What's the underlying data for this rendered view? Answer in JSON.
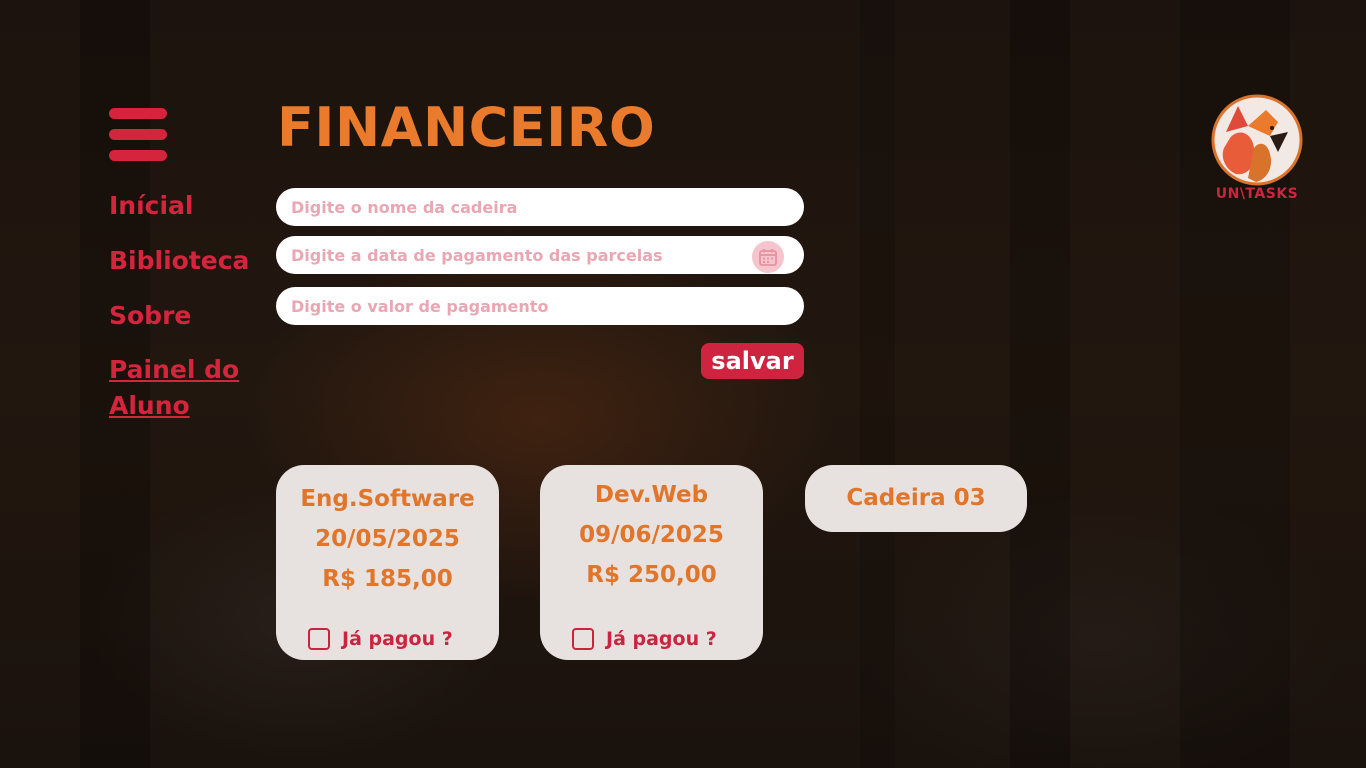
{
  "page": {
    "title": "FINANCEIRO"
  },
  "brand": {
    "logo_text": "UN\\TASKS",
    "primary_color": "#ea7a2c",
    "accent_color": "#d4253d"
  },
  "menu": {
    "icon": "hamburger-menu-icon"
  },
  "nav": {
    "items": [
      {
        "label": "Inícial"
      },
      {
        "label": "Biblioteca"
      },
      {
        "label": "Sobre"
      },
      {
        "label": "Painel do Aluno"
      }
    ]
  },
  "form": {
    "course_name": {
      "placeholder": "Digite o nome da cadeira",
      "value": ""
    },
    "payment_date": {
      "placeholder": "Digite a data de pagamento das parcelas",
      "value": "",
      "icon": "calendar-icon"
    },
    "payment_value": {
      "placeholder": "Digite o valor de pagamento",
      "value": ""
    },
    "save_label": "salvar"
  },
  "cards": [
    {
      "course": "Eng.Software",
      "date": "20/05/2025",
      "amount": "R$ 185,00",
      "paid_label": "Já pagou ?",
      "paid": false
    },
    {
      "course": "Dev.Web",
      "date": "09/06/2025",
      "amount": "R$ 250,00",
      "paid_label": "Já pagou ?",
      "paid": false
    },
    {
      "course": "Cadeira 03"
    }
  ]
}
